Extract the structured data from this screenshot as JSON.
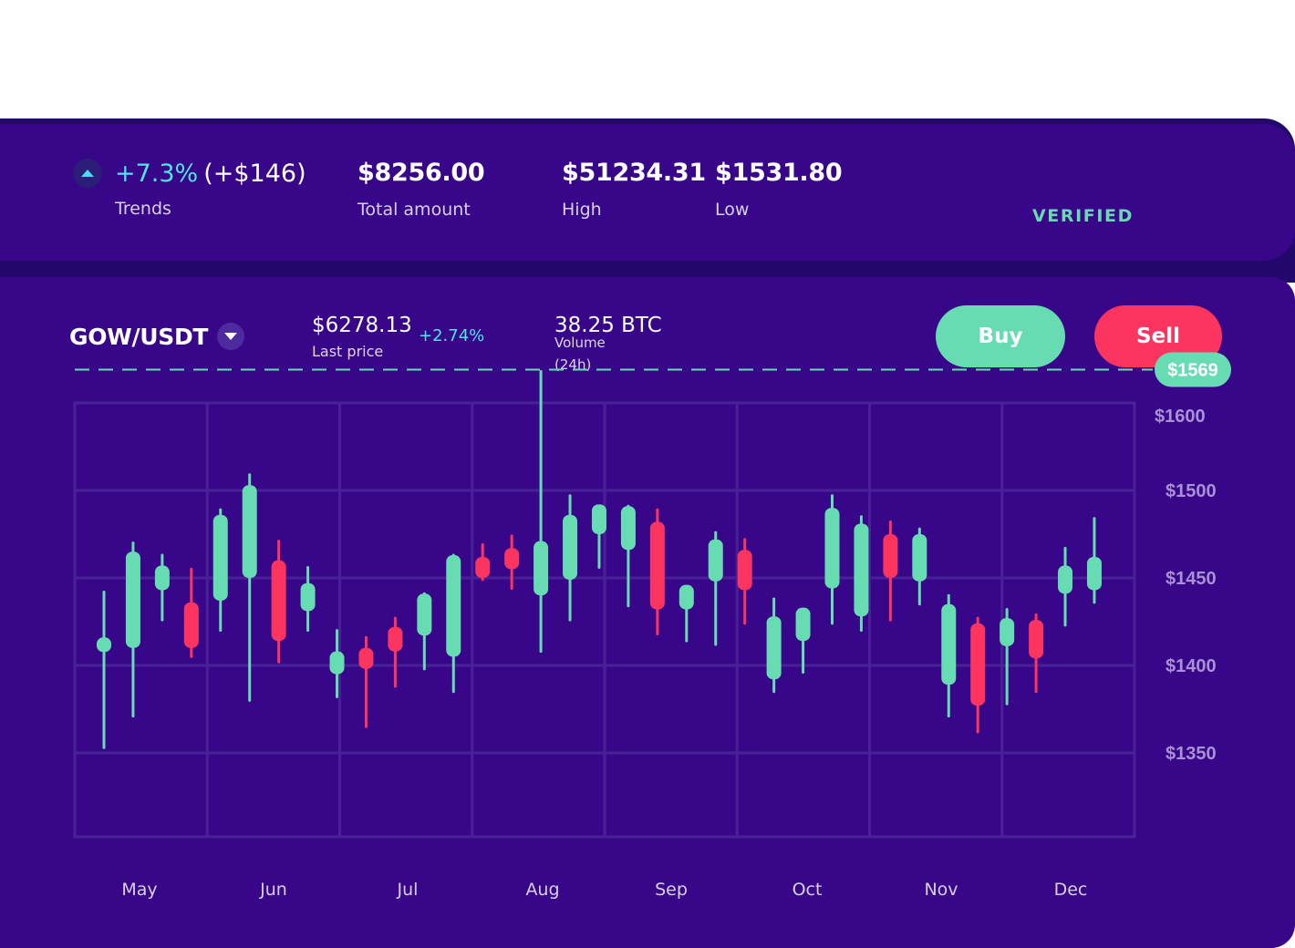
{
  "stats": {
    "trend": {
      "pct": "+7.3%",
      "abs": "(+$146)",
      "label": "Trends"
    },
    "total": {
      "value": "$8256.00",
      "label": "Total amount"
    },
    "high": {
      "value": "$51234.31",
      "label": "High"
    },
    "low": {
      "value": "$1531.80",
      "label": "Low"
    },
    "verified": "VERIFIED"
  },
  "market": {
    "pair": "GOW/USDT",
    "last_price": "$6278.13",
    "last_price_label": "Last price",
    "change": "+2.74%",
    "volume": "38.25 BTC",
    "volume_label": "Volume (24h)",
    "buy_label": "Buy",
    "sell_label": "Sell"
  },
  "colors": {
    "up": "#67dbb2",
    "down": "#fb3460",
    "background": "#380789",
    "grid": "#4a2098",
    "axis_text": "#a892d4"
  },
  "chart_data": {
    "type": "candlestick",
    "x_labels": [
      "May",
      "Jun",
      "Jul",
      "Aug",
      "Sep",
      "Oct",
      "Nov",
      "Dec"
    ],
    "y_ticks": [
      1600,
      1500,
      1450,
      1400,
      1350
    ],
    "y_tick_labels": [
      "$1600",
      "$1500",
      "$1450",
      "$1400",
      "$1350"
    ],
    "ylim": [
      1310,
      1560
    ],
    "current_price": 1569,
    "current_price_label": "$1569",
    "grid": true,
    "candles": [
      {
        "open": 1408,
        "high": 1442,
        "low": 1353,
        "close": 1416
      },
      {
        "open": 1410,
        "high": 1470,
        "low": 1371,
        "close": 1465
      },
      {
        "open": 1443,
        "high": 1463,
        "low": 1426,
        "close": 1457
      },
      {
        "open": 1436,
        "high": 1455,
        "low": 1405,
        "close": 1410
      },
      {
        "open": 1437,
        "high": 1489,
        "low": 1420,
        "close": 1486
      },
      {
        "open": 1450,
        "high": 1509,
        "low": 1380,
        "close": 1503
      },
      {
        "open": 1460,
        "high": 1471,
        "low": 1402,
        "close": 1414
      },
      {
        "open": 1431,
        "high": 1456,
        "low": 1420,
        "close": 1447
      },
      {
        "open": 1395,
        "high": 1420,
        "low": 1382,
        "close": 1408
      },
      {
        "open": 1410,
        "high": 1416,
        "low": 1365,
        "close": 1398
      },
      {
        "open": 1422,
        "high": 1427,
        "low": 1388,
        "close": 1408
      },
      {
        "open": 1417,
        "high": 1441,
        "low": 1398,
        "close": 1441
      },
      {
        "open": 1405,
        "high": 1463,
        "low": 1385,
        "close": 1463
      },
      {
        "open": 1462,
        "high": 1469,
        "low": 1449,
        "close": 1450
      },
      {
        "open": 1467,
        "high": 1474,
        "low": 1444,
        "close": 1455
      },
      {
        "open": 1440,
        "high": 1568,
        "low": 1408,
        "close": 1471
      },
      {
        "open": 1449,
        "high": 1497,
        "low": 1426,
        "close": 1486
      },
      {
        "open": 1475,
        "high": 1490,
        "low": 1456,
        "close": 1492
      },
      {
        "open": 1466,
        "high": 1491,
        "low": 1434,
        "close": 1491
      },
      {
        "open": 1482,
        "high": 1489,
        "low": 1418,
        "close": 1432
      },
      {
        "open": 1432,
        "high": 1443,
        "low": 1414,
        "close": 1446
      },
      {
        "open": 1448,
        "high": 1476,
        "low": 1412,
        "close": 1472
      },
      {
        "open": 1466,
        "high": 1472,
        "low": 1424,
        "close": 1443
      },
      {
        "open": 1392,
        "high": 1438,
        "low": 1385,
        "close": 1428
      },
      {
        "open": 1414,
        "high": 1431,
        "low": 1396,
        "close": 1433
      },
      {
        "open": 1444,
        "high": 1497,
        "low": 1424,
        "close": 1490
      },
      {
        "open": 1428,
        "high": 1485,
        "low": 1420,
        "close": 1481
      },
      {
        "open": 1475,
        "high": 1482,
        "low": 1426,
        "close": 1450
      },
      {
        "open": 1448,
        "high": 1478,
        "low": 1435,
        "close": 1475
      },
      {
        "open": 1389,
        "high": 1440,
        "low": 1371,
        "close": 1435
      },
      {
        "open": 1424,
        "high": 1427,
        "low": 1362,
        "close": 1377
      },
      {
        "open": 1411,
        "high": 1432,
        "low": 1378,
        "close": 1427
      },
      {
        "open": 1426,
        "high": 1429,
        "low": 1385,
        "close": 1404
      },
      {
        "open": 1441,
        "high": 1467,
        "low": 1423,
        "close": 1457
      },
      {
        "open": 1443,
        "high": 1484,
        "low": 1436,
        "close": 1462
      }
    ]
  }
}
